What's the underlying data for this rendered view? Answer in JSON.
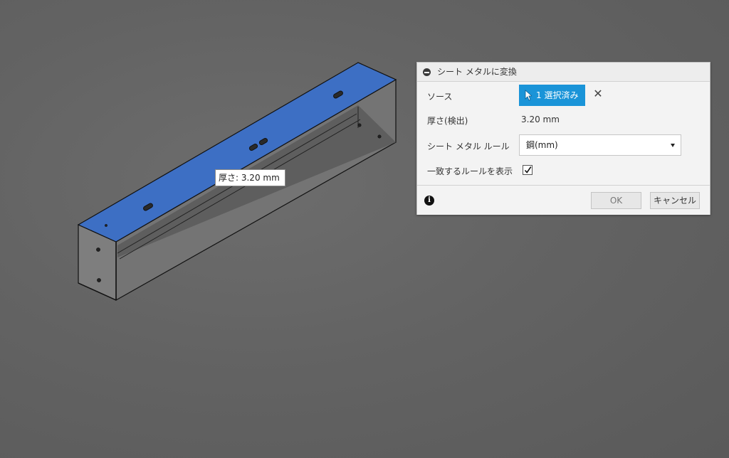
{
  "viewport": {
    "tooltip_text": "厚さ: 3.20 mm"
  },
  "dialog": {
    "title": "シート メタルに変換",
    "source_label": "ソース",
    "source_value": "1 選択済み",
    "thickness_label": "厚さ(検出)",
    "thickness_value": "3.20 mm",
    "rule_label": "シート メタル ルール",
    "rule_value": "鋼(mm)",
    "show_rules_label": "一致するルールを表示",
    "show_rules_checked": true,
    "ok_label": "OK",
    "cancel_label": "キャンセル"
  },
  "icons": {
    "collapse": "collapse-icon",
    "cursor": "cursor-arrow-icon",
    "clear": "close-icon",
    "dropdown": "chevron-down-icon",
    "check": "checkmark-icon",
    "info": "info-icon"
  },
  "colors": {
    "viewport_bg": "#666666",
    "selected_face": "#3d6fc4",
    "select_button": "#1a94d8"
  }
}
